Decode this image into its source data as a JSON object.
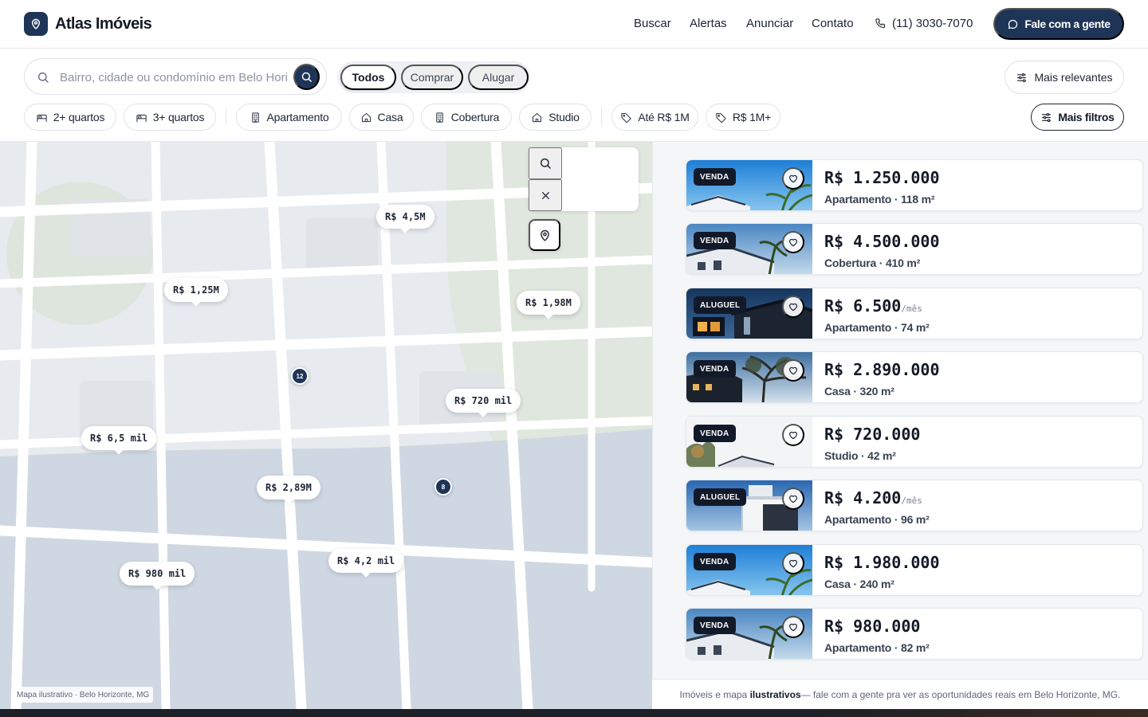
{
  "brand": {
    "name": "Atlas Imóveis",
    "accent": "#1f3557"
  },
  "nav": {
    "items": [
      "Buscar",
      "Alertas",
      "Anunciar",
      "Contato"
    ],
    "phone": "(11) 3030-7070",
    "cta": "Fale com a gente"
  },
  "search": {
    "placeholder": "Bairro, cidade ou condomínio em Belo Horizonte",
    "value": ""
  },
  "segments": {
    "items": [
      "Todos",
      "Comprar",
      "Alugar"
    ],
    "active": "Todos"
  },
  "sort": {
    "label": "Mais relevantes"
  },
  "filters": {
    "chips": [
      "2+ quartos",
      "3+ quartos",
      "Apartamento",
      "Casa",
      "Cobertura",
      "Studio",
      "Até R$ 1M",
      "R$ 1M+"
    ],
    "more": "Mais filtros"
  },
  "map": {
    "pins": [
      "R$ 4,5M",
      "R$ 1,25M",
      "R$ 1,98M",
      "R$ 720 mil",
      "R$ 6,5 mil",
      "R$ 2,89M",
      "R$ 4,2 mil",
      "R$ 980 mil"
    ],
    "clusters": [
      "12",
      "8"
    ],
    "credit": "Mapa ilustrativo · Belo Horizonte, MG",
    "icons": [
      "search-icon",
      "close-icon",
      "location-pin-icon"
    ]
  },
  "listings": [
    {
      "badge": "VENDA",
      "price": "R$ 1.250.000",
      "per": "",
      "meta": "Apartamento · 118 m²"
    },
    {
      "badge": "VENDA",
      "price": "R$ 4.500.000",
      "per": "",
      "meta": "Cobertura · 410 m²"
    },
    {
      "badge": "ALUGUEL",
      "price": "R$ 6.500",
      "per": "/mês",
      "meta": "Apartamento · 74 m²"
    },
    {
      "badge": "VENDA",
      "price": "R$ 2.890.000",
      "per": "",
      "meta": "Casa · 320 m²"
    },
    {
      "badge": "VENDA",
      "price": "R$ 720.000",
      "per": "",
      "meta": "Studio · 42 m²"
    },
    {
      "badge": "ALUGUEL",
      "price": "R$ 4.200",
      "per": "/mês",
      "meta": "Apartamento · 96 m²"
    },
    {
      "badge": "VENDA",
      "price": "R$ 1.980.000",
      "per": "",
      "meta": "Casa · 240 m²"
    },
    {
      "badge": "VENDA",
      "price": "R$ 980.000",
      "per": "",
      "meta": "Apartamento · 82 m²"
    }
  ],
  "footer": {
    "prefix": "Imóveis e mapa ",
    "emphasis": "ilustrativos",
    "suffix": " — fale com a gente pra ver as oportunidades reais em Belo Horizonte, MG."
  }
}
